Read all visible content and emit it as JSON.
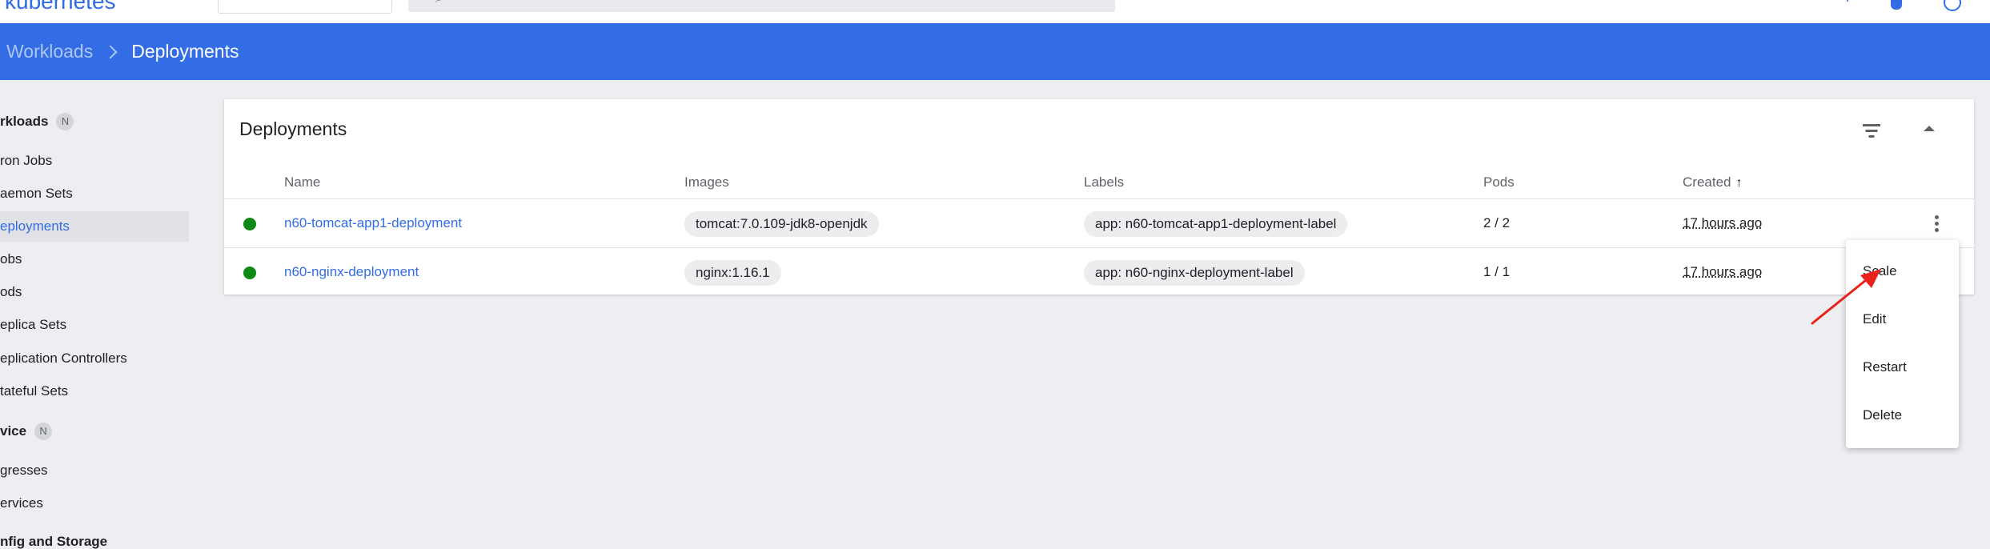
{
  "topbar": {
    "logo_text": "kubernetes",
    "search_glyph": "⌕",
    "icons": [
      "plus-icon",
      "bell-icon",
      "account-icon"
    ]
  },
  "breadcrumb": {
    "parent": "Workloads",
    "current": "Deployments"
  },
  "sidebar": {
    "items": [
      {
        "label": "rkloads",
        "type": "section",
        "badge": "N"
      },
      {
        "label": "ron Jobs",
        "type": "item"
      },
      {
        "label": "aemon Sets",
        "type": "item"
      },
      {
        "label": "eployments",
        "type": "item",
        "active": true
      },
      {
        "label": "obs",
        "type": "item"
      },
      {
        "label": "ods",
        "type": "item"
      },
      {
        "label": "eplica Sets",
        "type": "item"
      },
      {
        "label": "eplication Controllers",
        "type": "item"
      },
      {
        "label": "tateful Sets",
        "type": "item"
      },
      {
        "label": "vice",
        "type": "section",
        "badge": "N"
      },
      {
        "label": "gresses",
        "type": "item"
      },
      {
        "label": "ervices",
        "type": "item"
      },
      {
        "label": "nfig and Storage",
        "type": "section"
      }
    ]
  },
  "card": {
    "title": "Deployments",
    "columns": {
      "name": "Name",
      "images": "Images",
      "labels": "Labels",
      "pods": "Pods",
      "created": "Created",
      "sort_arrow": "↑"
    },
    "rows": [
      {
        "status": "running",
        "name": "n60-tomcat-app1-deployment",
        "image": "tomcat:7.0.109-jdk8-openjdk",
        "label": "app: n60-tomcat-app1-deployment-label",
        "pods": "2 / 2",
        "created": "17 hours ago"
      },
      {
        "status": "running",
        "name": "n60-nginx-deployment",
        "image": "nginx:1.16.1",
        "label": "app: n60-nginx-deployment-label",
        "pods": "1 / 1",
        "created": "17 hours ago"
      }
    ]
  },
  "menu": {
    "items": [
      "Scale",
      "Edit",
      "Restart",
      "Delete"
    ]
  },
  "colors": {
    "brand_blue": "#326de6",
    "status_green": "#0e8a16",
    "annotation_red": "#e8231b"
  }
}
